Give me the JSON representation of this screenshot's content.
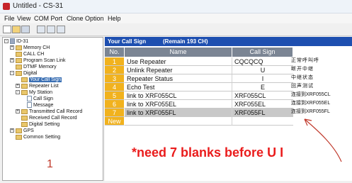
{
  "window": {
    "title": "Untitled - CS-31"
  },
  "menu": [
    "File",
    "View",
    "COM Port",
    "Clone",
    "Option",
    "Help"
  ],
  "tree": {
    "root": "ID-31",
    "items": [
      "Memory CH",
      "CALL CH",
      "Program Scan Link",
      "DTMF Memory",
      "Digital",
      "Your Call Sign",
      "Repeater List",
      "My Station",
      "Call Sign",
      "Message",
      "Transmitted Call Record",
      "Received Call Record",
      "Digital Setting",
      "GPS",
      "Common Setting"
    ],
    "selected": "Your Call Sign",
    "annotation_number": "1"
  },
  "panel": {
    "title": "Your Call Sign",
    "remain": "(Remain 193 CH)",
    "columns": [
      "No.",
      "Name",
      "Call Sign"
    ],
    "rows": [
      {
        "no": "1",
        "name": "Use Repeater",
        "call": "CQCQCQ",
        "cn": "正常呼叫呼"
      },
      {
        "no": "2",
        "name": "Unlink Repeater",
        "call": "U",
        "cn": "断开中继"
      },
      {
        "no": "3",
        "name": "Repeater Status",
        "call": "I",
        "cn": "中继状态"
      },
      {
        "no": "4",
        "name": "Echo Test",
        "call": "E",
        "cn": "回声测试"
      },
      {
        "no": "5",
        "name": "link to XRF055CL",
        "call": "XRF055CL",
        "cn": "连接到XRF055CL"
      },
      {
        "no": "6",
        "name": "link to XRF055EL",
        "call": "XRF055EL",
        "cn": "连接到XRF055EL"
      },
      {
        "no": "7",
        "name": "link to XRF055FL",
        "call": "XRF055FL",
        "cn": "连接到XRF055FL"
      },
      {
        "no": "New",
        "name": "",
        "call": "",
        "cn": ""
      }
    ]
  },
  "annotation": {
    "note": "*need 7 blanks before U I"
  },
  "colors": {
    "header_bar": "#1e4fb0",
    "row_number": "#f1b21e",
    "annotation": "#ea1c1c"
  }
}
